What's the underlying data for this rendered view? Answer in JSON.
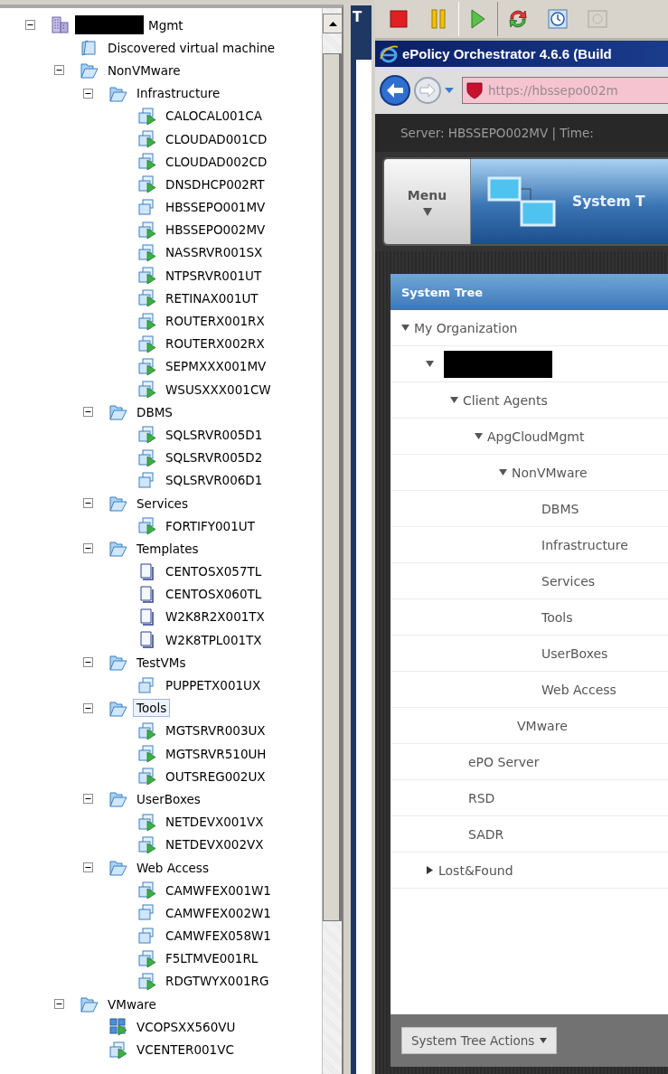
{
  "inventory_tree": [
    {
      "kind": "datacenter",
      "label": "Mgmt",
      "redacted_prefix": true,
      "expanded": true,
      "selected": false,
      "children": [
        {
          "kind": "folder",
          "label": "Discovered virtual machine",
          "selected": false
        },
        {
          "kind": "folder",
          "label": "NonVMware",
          "expanded": true,
          "selected": false,
          "children": [
            {
              "kind": "folder",
              "label": "Infrastructure",
              "expanded": true,
              "selected": false,
              "children": [
                {
                  "kind": "vm",
                  "label": "CALOCAL001CA",
                  "powered_on": true,
                  "selected": false
                },
                {
                  "kind": "vm",
                  "label": "CLOUDAD001CD",
                  "powered_on": true,
                  "selected": false
                },
                {
                  "kind": "vm",
                  "label": "CLOUDAD002CD",
                  "powered_on": true,
                  "selected": false
                },
                {
                  "kind": "vm",
                  "label": "DNSDHCP002RT",
                  "powered_on": true,
                  "selected": false
                },
                {
                  "kind": "vm",
                  "label": "HBSSEPO001MV",
                  "powered_on": false,
                  "selected": false
                },
                {
                  "kind": "vm",
                  "label": "HBSSEPO002MV",
                  "powered_on": true,
                  "selected": false
                },
                {
                  "kind": "vm",
                  "label": "NASSRVR001SX",
                  "powered_on": true,
                  "selected": false
                },
                {
                  "kind": "vm",
                  "label": "NTPSRVR001UT",
                  "powered_on": true,
                  "selected": false
                },
                {
                  "kind": "vm",
                  "label": "RETINAX001UT",
                  "powered_on": true,
                  "selected": false
                },
                {
                  "kind": "vm",
                  "label": "ROUTERX001RX",
                  "powered_on": true,
                  "selected": false
                },
                {
                  "kind": "vm",
                  "label": "ROUTERX002RX",
                  "powered_on": true,
                  "selected": false
                },
                {
                  "kind": "vm",
                  "label": "SEPMXXX001MV",
                  "powered_on": true,
                  "selected": false
                },
                {
                  "kind": "vm",
                  "label": "WSUSXXX001CW",
                  "powered_on": true,
                  "selected": false
                }
              ]
            },
            {
              "kind": "folder",
              "label": "DBMS",
              "expanded": true,
              "selected": false,
              "children": [
                {
                  "kind": "vm",
                  "label": "SQLSRVR005D1",
                  "powered_on": true,
                  "selected": false
                },
                {
                  "kind": "vm",
                  "label": "SQLSRVR005D2",
                  "powered_on": true,
                  "selected": false
                },
                {
                  "kind": "vm",
                  "label": "SQLSRVR006D1",
                  "powered_on": false,
                  "selected": false
                }
              ]
            },
            {
              "kind": "folder",
              "label": "Services",
              "expanded": true,
              "selected": false,
              "children": [
                {
                  "kind": "vm",
                  "label": "FORTIFY001UT",
                  "powered_on": true,
                  "selected": false
                }
              ]
            },
            {
              "kind": "folder",
              "label": "Templates",
              "expanded": true,
              "selected": false,
              "children": [
                {
                  "kind": "template",
                  "label": "CENTOSX057TL",
                  "selected": false
                },
                {
                  "kind": "template",
                  "label": "CENTOSX060TL",
                  "selected": false
                },
                {
                  "kind": "template",
                  "label": "W2K8R2X001TX",
                  "selected": false
                },
                {
                  "kind": "template",
                  "label": "W2K8TPL001TX",
                  "selected": false
                }
              ]
            },
            {
              "kind": "folder",
              "label": "TestVMs",
              "expanded": true,
              "selected": false,
              "children": [
                {
                  "kind": "vm",
                  "label": "PUPPETX001UX",
                  "powered_on": false,
                  "selected": false
                }
              ]
            },
            {
              "kind": "folder",
              "label": "Tools",
              "expanded": true,
              "selected": true,
              "children": [
                {
                  "kind": "vm",
                  "label": "MGTSRVR003UX",
                  "powered_on": true,
                  "selected": false
                },
                {
                  "kind": "vm",
                  "label": "MGTSRVR510UH",
                  "powered_on": true,
                  "selected": false
                },
                {
                  "kind": "vm",
                  "label": "OUTSREG002UX",
                  "powered_on": true,
                  "selected": false
                }
              ]
            },
            {
              "kind": "folder",
              "label": "UserBoxes",
              "expanded": true,
              "selected": false,
              "children": [
                {
                  "kind": "vm",
                  "label": "NETDEVX001VX",
                  "powered_on": true,
                  "selected": false
                },
                {
                  "kind": "vm",
                  "label": "NETDEVX002VX",
                  "powered_on": true,
                  "selected": false
                }
              ]
            },
            {
              "kind": "folder",
              "label": "Web Access",
              "expanded": true,
              "selected": false,
              "children": [
                {
                  "kind": "vm",
                  "label": "CAMWFEX001W1",
                  "powered_on": true,
                  "selected": false
                },
                {
                  "kind": "vm",
                  "label": "CAMWFEX002W1",
                  "powered_on": false,
                  "selected": false
                },
                {
                  "kind": "vm",
                  "label": "CAMWFEX058W1",
                  "powered_on": false,
                  "selected": false
                },
                {
                  "kind": "vm",
                  "label": "F5LTMVE001RL",
                  "powered_on": true,
                  "selected": false
                },
                {
                  "kind": "vm",
                  "label": "RDGTWYX001RG",
                  "powered_on": true,
                  "selected": false
                }
              ]
            }
          ]
        },
        {
          "kind": "folder",
          "label": "VMware",
          "expanded": true,
          "selected": false,
          "children": [
            {
              "kind": "vapp",
              "label": "VCOPSXX560VU",
              "powered_on": true,
              "selected": false
            },
            {
              "kind": "vm",
              "label": "VCENTER001VC",
              "powered_on": true,
              "selected": false
            }
          ]
        }
      ]
    }
  ],
  "side_panel": {
    "tab_label": "T"
  },
  "browser": {
    "title": "ePolicy Orchestrator 4.6.6 (Build",
    "url": "https://hbssepo002m",
    "server_info": "Server: HBSSEPO002MV | Time:",
    "menu_label": "Menu",
    "section_title": "System T",
    "system_tree": {
      "title": "System Tree",
      "actions_button": "System Tree Actions",
      "nodes": [
        {
          "label": "My Organization",
          "expanded": true,
          "children": [
            {
              "redacted": true,
              "expanded": true,
              "children": [
                {
                  "label": "Client Agents",
                  "expanded": true,
                  "children": [
                    {
                      "label": "ApgCloudMgmt",
                      "expanded": true,
                      "children": [
                        {
                          "label": "NonVMware",
                          "expanded": true,
                          "children": [
                            {
                              "label": "DBMS"
                            },
                            {
                              "label": "Infrastructure"
                            },
                            {
                              "label": "Services"
                            },
                            {
                              "label": "Tools"
                            },
                            {
                              "label": "UserBoxes"
                            },
                            {
                              "label": "Web Access"
                            }
                          ]
                        },
                        {
                          "label": "VMware"
                        }
                      ]
                    }
                  ]
                },
                {
                  "label": "ePO Server"
                },
                {
                  "label": "RSD"
                },
                {
                  "label": "SADR"
                }
              ]
            },
            {
              "label": "Lost&Found",
              "expanded": false
            }
          ]
        }
      ]
    }
  }
}
